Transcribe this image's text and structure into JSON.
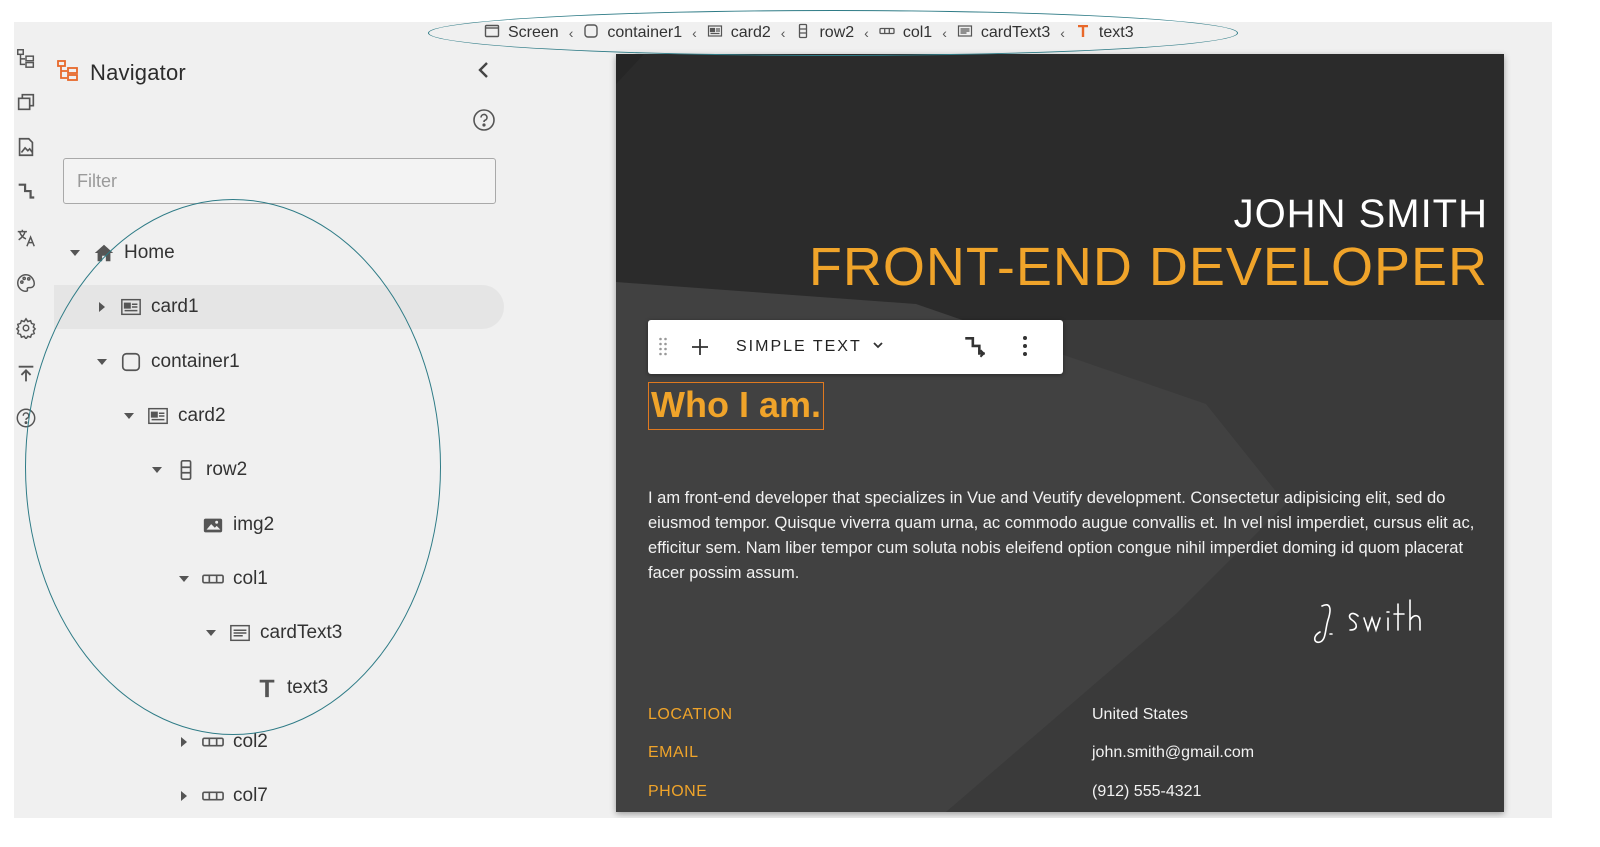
{
  "navigator": {
    "title": "Navigator",
    "filter_placeholder": "Filter"
  },
  "rail_icons": [
    "navigator-icon",
    "layers-icon",
    "assets-icon",
    "flow-icon",
    "translate-icon",
    "palette-icon",
    "settings-icon",
    "upload-icon",
    "help-icon"
  ],
  "tree": [
    {
      "label": "Home",
      "icon": "home-icon",
      "expanded": true
    },
    {
      "label": "card1",
      "icon": "card-icon",
      "expanded": false,
      "hovered": true
    },
    {
      "label": "container1",
      "icon": "container-icon",
      "expanded": true
    },
    {
      "label": "card2",
      "icon": "card-icon",
      "expanded": true
    },
    {
      "label": "row2",
      "icon": "row-icon",
      "expanded": true
    },
    {
      "label": "img2",
      "icon": "image-icon"
    },
    {
      "label": "col1",
      "icon": "column-icon",
      "expanded": true
    },
    {
      "label": "cardText3",
      "icon": "card-text-icon",
      "expanded": true
    },
    {
      "label": "text3",
      "icon": "text-icon"
    },
    {
      "label": "col2",
      "icon": "column-icon",
      "expanded": false
    },
    {
      "label": "col7",
      "icon": "column-icon",
      "expanded": false
    }
  ],
  "breadcrumb": [
    {
      "label": "Screen",
      "icon": "screen-icon"
    },
    {
      "label": "container1",
      "icon": "container-icon"
    },
    {
      "label": "card2",
      "icon": "card-icon"
    },
    {
      "label": "row2",
      "icon": "row-icon"
    },
    {
      "label": "col1",
      "icon": "column-icon"
    },
    {
      "label": "cardText3",
      "icon": "card-text-icon"
    },
    {
      "label": "text3",
      "icon": "text-icon"
    }
  ],
  "canvas": {
    "name": "JOHN SMITH",
    "role": "FRONT-END DEVELOPER",
    "toolbar": {
      "type_label": "SIMPLE TEXT"
    },
    "heading": "Who I am.",
    "bio": "I am front-end developer that specializes in Vue and Veutify development. Consectetur adipisicing elit, sed do eiusmod tempor. Quisque viverra quam urna, ac commodo augue convallis et. In vel nisl imperdiet, cursus elit ac, efficitur sem. Nam liber tempor cum soluta nobis eleifend option congue nihil imperdiet doming id quom placerat facer possim assum.",
    "signature": "J. Smith",
    "info": [
      {
        "label": "LOCATION",
        "value": "United States"
      },
      {
        "label": "EMAIL",
        "value": "john.smith@gmail.com"
      },
      {
        "label": "PHONE",
        "value": "(912) 555-4321"
      }
    ]
  },
  "colors": {
    "accent": "#f0a42a",
    "brand_icon": "#e8682a",
    "annotation": "#2e7b86",
    "card_bg": "#3a3a3a",
    "card_header_bg": "#2b2b2b"
  }
}
